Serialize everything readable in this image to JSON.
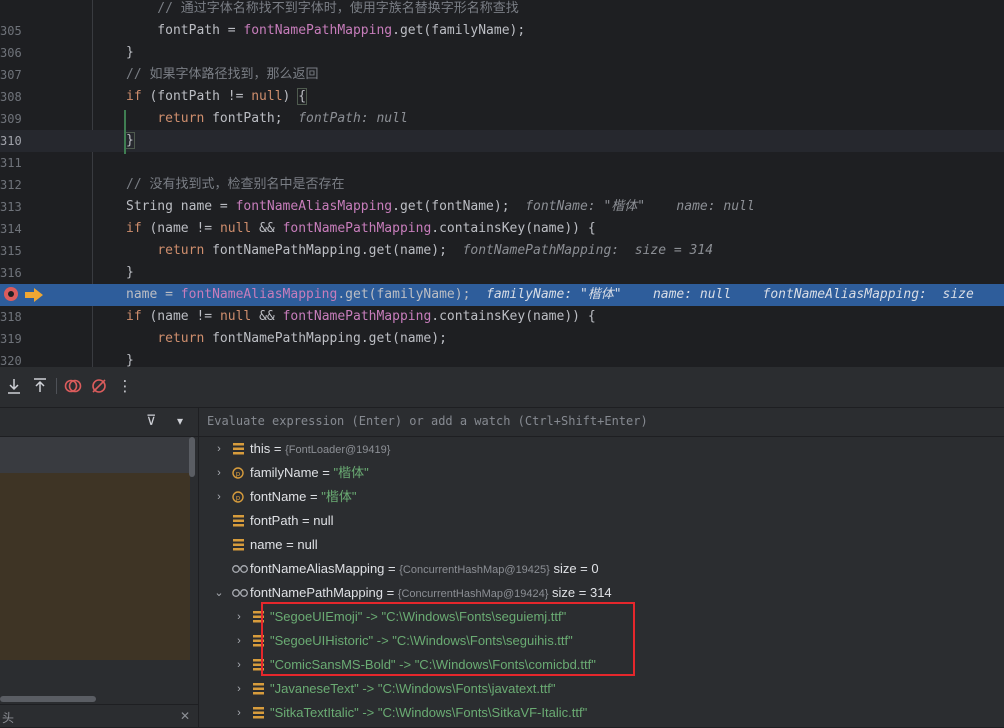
{
  "editor": {
    "lines": [
      {
        "num": "",
        "segments": [
          {
            "t": "    // 通过字体名称找不到字体时，使用字族名替换字形名称查找",
            "c": "cm"
          }
        ]
      },
      {
        "num": "305",
        "segments": [
          {
            "t": "    fontPath = ",
            "c": ""
          },
          {
            "t": "fontNamePathMapping",
            "c": "fld"
          },
          {
            "t": ".get(familyName);",
            "c": ""
          }
        ]
      },
      {
        "num": "306",
        "segments": [
          {
            "t": "}",
            "c": ""
          }
        ]
      },
      {
        "num": "307",
        "segments": [
          {
            "t": "// 如果字体路径找到，那么返回",
            "c": "cm"
          }
        ]
      },
      {
        "num": "308",
        "segments": [
          {
            "t": "if",
            "c": "kw"
          },
          {
            "t": " (fontPath != ",
            "c": ""
          },
          {
            "t": "null",
            "c": "kw"
          },
          {
            "t": ") ",
            "c": ""
          },
          {
            "t": "{",
            "c": "brace-m"
          }
        ]
      },
      {
        "num": "309",
        "segments": [
          {
            "t": "    ",
            "c": ""
          },
          {
            "t": "return",
            "c": "kw"
          },
          {
            "t": " fontPath;  ",
            "c": ""
          },
          {
            "t": "fontPath: null",
            "c": "hint"
          }
        ]
      },
      {
        "num": "310",
        "segments": [
          {
            "t": "}",
            "c": "brace-m"
          }
        ]
      },
      {
        "num": "311",
        "segments": []
      },
      {
        "num": "312",
        "segments": [
          {
            "t": "// 没有找到式，检查别名中是否存在",
            "c": "cm"
          }
        ]
      },
      {
        "num": "313",
        "segments": [
          {
            "t": "String name = ",
            "c": ""
          },
          {
            "t": "fontNameAliasMapping",
            "c": "fld"
          },
          {
            "t": ".get(fontName);  ",
            "c": ""
          },
          {
            "t": "fontName: \"楷体\"    name: null",
            "c": "hint"
          }
        ]
      },
      {
        "num": "314",
        "segments": [
          {
            "t": "if",
            "c": "kw"
          },
          {
            "t": " (name != ",
            "c": ""
          },
          {
            "t": "null",
            "c": "kw"
          },
          {
            "t": " && ",
            "c": ""
          },
          {
            "t": "fontNamePathMapping",
            "c": "fld"
          },
          {
            "t": ".containsKey(name)) {",
            "c": ""
          }
        ]
      },
      {
        "num": "315",
        "segments": [
          {
            "t": "    ",
            "c": ""
          },
          {
            "t": "return",
            "c": "kw"
          },
          {
            "t": " fontNamePathMapping.get(name);  ",
            "c": ""
          },
          {
            "t": "fontNamePathMapping:  size = 314",
            "c": "hint"
          }
        ]
      },
      {
        "num": "316",
        "segments": [
          {
            "t": "}",
            "c": ""
          }
        ]
      },
      {
        "num": "",
        "segments": [
          {
            "t": "name = ",
            "c": ""
          },
          {
            "t": "fontNameAliasMapping",
            "c": "fld"
          },
          {
            "t": ".get(familyName);  ",
            "c": ""
          },
          {
            "t": "familyName: \"楷体\"    name: null    fontNameAliasMapping:  size",
            "c": "hint"
          }
        ]
      },
      {
        "num": "318",
        "segments": [
          {
            "t": "if",
            "c": "kw"
          },
          {
            "t": " (name != ",
            "c": ""
          },
          {
            "t": "null",
            "c": "kw"
          },
          {
            "t": " && ",
            "c": ""
          },
          {
            "t": "fontNamePathMapping",
            "c": "fld"
          },
          {
            "t": ".containsKey(name)) {",
            "c": ""
          }
        ]
      },
      {
        "num": "319",
        "segments": [
          {
            "t": "    ",
            "c": ""
          },
          {
            "t": "return",
            "c": "kw"
          },
          {
            "t": " fontNamePathMapping.get(name);",
            "c": ""
          }
        ]
      },
      {
        "num": "320",
        "segments": [
          {
            "t": "}",
            "c": ""
          }
        ]
      }
    ]
  },
  "toolbar": {
    "icons": [
      "download-icon",
      "upload-icon",
      "view-breakpoints-icon",
      "mute-breakpoints-icon",
      "more-options-icon"
    ],
    "more_glyph": "⋮"
  },
  "frames": {
    "filter_glyph": "⊽",
    "dropdown_glyph": "▾",
    "footer_label": "头",
    "close_glyph": "✕"
  },
  "variables": {
    "eval_placeholder": "Evaluate expression (Enter) or add a watch (Ctrl+Shift+Enter)",
    "rows": [
      {
        "chev": "›",
        "icon": "field",
        "name": "this",
        "eq": " = ",
        "type": "{FontLoader@19419}",
        "value": "",
        "indent": 0
      },
      {
        "chev": "›",
        "icon": "param",
        "name": "familyName",
        "eq": " = ",
        "type": "",
        "value": "\"楷体\"",
        "indent": 0
      },
      {
        "chev": "›",
        "icon": "param",
        "name": "fontName",
        "eq": " = ",
        "type": "",
        "value": "\"楷体\"",
        "indent": 0
      },
      {
        "chev": "",
        "icon": "field",
        "name": "fontPath",
        "eq": " = ",
        "type": "",
        "value": "null",
        "indent": 0
      },
      {
        "chev": "",
        "icon": "field",
        "name": "name",
        "eq": " = ",
        "type": "",
        "value": "null",
        "indent": 0
      },
      {
        "chev": "",
        "icon": "watch",
        "name": "fontNameAliasMapping",
        "eq": " = ",
        "type": "{ConcurrentHashMap@19425}",
        "value": " size = 0",
        "indent": 0
      },
      {
        "chev": "⌄",
        "icon": "watch",
        "name": "fontNamePathMapping",
        "eq": " = ",
        "type": "{ConcurrentHashMap@19424}",
        "value": " size = 314",
        "indent": 0
      },
      {
        "chev": "›",
        "icon": "field",
        "name": "",
        "eq": "",
        "type": "",
        "value": "\"SegoeUIEmoji\" -> \"C:\\Windows\\Fonts\\seguiemj.ttf\"",
        "indent": 1
      },
      {
        "chev": "›",
        "icon": "field",
        "name": "",
        "eq": "",
        "type": "",
        "value": "\"SegoeUIHistoric\" -> \"C:\\Windows\\Fonts\\seguihis.ttf\"",
        "indent": 1
      },
      {
        "chev": "›",
        "icon": "field",
        "name": "",
        "eq": "",
        "type": "",
        "value": "\"ComicSansMS-Bold\" -> \"C:\\Windows\\Fonts\\comicbd.ttf\"",
        "indent": 1
      },
      {
        "chev": "›",
        "icon": "field",
        "name": "",
        "eq": "",
        "type": "",
        "value": "\"JavaneseText\" -> \"C:\\Windows\\Fonts\\javatext.ttf\"",
        "indent": 1
      },
      {
        "chev": "›",
        "icon": "field",
        "name": "",
        "eq": "",
        "type": "",
        "value": "\"SitkaTextItalic\" -> \"C:\\Windows\\Fonts\\SitkaVF-Italic.ttf\"",
        "indent": 1
      }
    ]
  }
}
